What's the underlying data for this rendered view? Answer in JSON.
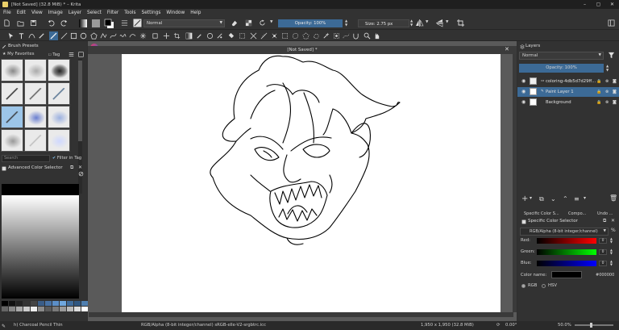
{
  "window": {
    "title": "[Not Saved]  (32.8 MiB)  * – Krita",
    "min": "–",
    "max": "▢",
    "close": "✕"
  },
  "menu": [
    "File",
    "Edit",
    "View",
    "Image",
    "Layer",
    "Select",
    "Filter",
    "Tools",
    "Settings",
    "Window",
    "Help"
  ],
  "toolbar": {
    "blend_mode": "Normal",
    "opacity": "Opacity: 100%",
    "size": "Size: 2.75 px"
  },
  "brush_presets": {
    "title": "Brush Presets",
    "tag_filter": "My Favorites",
    "tag_label": "Tag",
    "search_placeholder": "Search",
    "filter_in_tag": "Filter in Tag"
  },
  "color_selector": {
    "title": "Advanced Color Selector"
  },
  "document": {
    "tab_title": "[Not Saved]  *"
  },
  "layers": {
    "title": "Layers",
    "blend_mode": "Normal",
    "opacity": "Opacity:  100%",
    "items": [
      {
        "name": "coloring-4db5d7d29ff...",
        "selected": false
      },
      {
        "name": "Paint Layer 1",
        "selected": true
      },
      {
        "name": "Background",
        "selected": false
      }
    ]
  },
  "bottom_tabs": [
    "Specific Color S...",
    "Compo...",
    "Undo ..."
  ],
  "specific_color": {
    "title": "Specific Color Selector",
    "model": "RGB/Alpha (8-bit integer/channel)",
    "red_label": "Red:",
    "green_label": "Green:",
    "blue_label": "Blue:",
    "red_value": "0",
    "green_value": "0",
    "blue_value": "0",
    "color_name_label": "Color name:",
    "color_name": "#000000",
    "rgb_label": "RGB",
    "hsv_label": "HSV"
  },
  "status": {
    "brush": "h) Charcoal Pencil Thin",
    "color_space": "RGB/Alpha (8-bit integer/channel)  sRGB-elle-V2-srgbtrc.icc",
    "dimensions": "1,950 x 1,950 (32.8 MiB)",
    "rotation": "0.00°",
    "zoom": "50.0%"
  },
  "colors": {
    "accent": "#3c6a96",
    "dock_bg": "#323232",
    "canvas_bg": "#5a5a5a"
  }
}
